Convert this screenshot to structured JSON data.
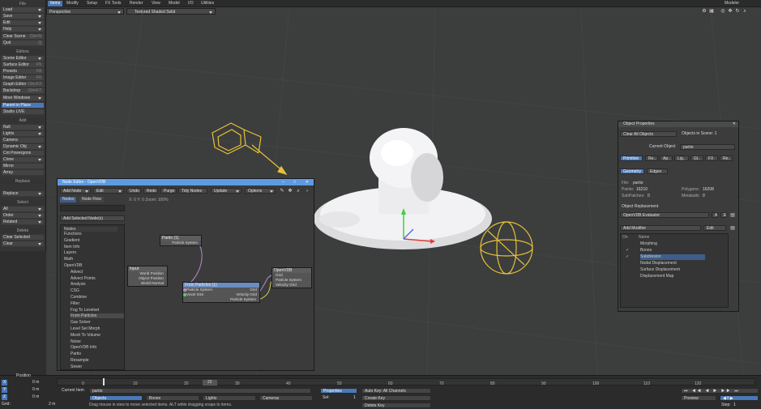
{
  "topbar": {
    "tabs": [
      "Items",
      "Modify",
      "Setup",
      "FX Tools",
      "Render",
      "View",
      "Model",
      "I/O",
      "Utilities"
    ],
    "active": "Items",
    "right_label": "Modeler"
  },
  "left": {
    "file": "File",
    "load": "Load",
    "save": "Save",
    "edit": "Edit",
    "help": "Help",
    "clear_scene": "Clear Scene",
    "clear_scene_key": "Ctrl+N",
    "quit": "Quit",
    "quit_key": "Q",
    "editors": "Editors",
    "scene_editor": "Scene Editor",
    "surface_editor": "Surface Editor",
    "surface_editor_key": "F5",
    "presets": "Presets",
    "presets_key": "F8",
    "image_editor": "Image Editor",
    "image_editor_key": "F6",
    "graph_editor": "Graph Editor",
    "graph_editor_key": "Ctrl+F2",
    "backdrop": "Backdrop",
    "backdrop_key": "Ctrl+F7",
    "more_windows": "More Windows",
    "parent_in_place": "Parent in Place",
    "studio_live": "Studio LIVE",
    "add": "Add",
    "null": "Null",
    "lights": "Lights",
    "camera": "Camera",
    "dynamic_obj": "Dynamic Obj",
    "cnt_powergons": "Cnt Powergons",
    "clone": "Clone",
    "mirror": "Mirror",
    "array": "Array",
    "replace_head": "Replace",
    "replace": "Replace",
    "select_head": "Select",
    "all": "All",
    "order": "Order",
    "related": "Related",
    "delete_head": "Delete",
    "clear_selected": "Clear Selected",
    "clear": "Clear"
  },
  "viewport": {
    "view": "Perspective",
    "shading": "Textured Shaded Solid"
  },
  "node_editor": {
    "title": "Node Editor - OpenVDB",
    "add_node": "Add Node",
    "edit": "Edit",
    "undo": "Undo",
    "redo": "Redo",
    "purge": "Purge",
    "tidy": "Tidy Nodes",
    "update": "Update",
    "options": "Options",
    "tab_nodes": "Nodes",
    "tab_flow": "Node Flow",
    "coords": "X: 0 Y: 0 Zoom: 100%",
    "add_selected": "Add Selected Node(s)",
    "nodes_label": "Nodes",
    "tree": [
      "Functions",
      "Gradient",
      "Item Info",
      "Layers",
      "Math",
      "OpenVDB",
      "Advect",
      "Advect Points",
      "Analysis",
      "CSG",
      "Combine",
      "Filter",
      "Fog To Levelset",
      "From Particles",
      "Gas Solver",
      "Level Set Morph",
      "Mesh To Volume",
      "Noise",
      "OpenVDB Info",
      "Partio",
      "Resample",
      "Sewer"
    ],
    "nodes": {
      "partio": {
        "title": "Partio (1)",
        "ports": [
          "Particle System"
        ]
      },
      "input": {
        "title": "Input",
        "ports": [
          "World Position",
          "Object Position",
          "World Normal"
        ]
      },
      "from_particles": {
        "title": "From Particles (1)",
        "ports": [
          "Particle System",
          "Grid",
          "Voxel Size",
          "Velocity Grid",
          "Particle System"
        ]
      },
      "openvdb": {
        "title": "OpenVDB",
        "ports": [
          "Grid",
          "Particle System",
          "Velocity Grid"
        ]
      }
    }
  },
  "properties": {
    "title": "Object Properties",
    "clear_all": "Clear All Objects",
    "objects_in_scene": "Objects in Scene: 1",
    "current_object_label": "Current Object",
    "current_object": "partio",
    "tabs": [
      "Primitive",
      "Re..",
      "Ap..",
      "Lig..",
      "Gl..",
      "FX",
      "Re.."
    ],
    "subtabs": [
      "Geometry",
      "Edges"
    ],
    "file_label": "File:",
    "file": "partio",
    "points_label": "Points:",
    "points": "16210",
    "polygons_label": "Polygons:",
    "polygons": "16208",
    "subpatches_label": "SubPatches:",
    "subpatches": "0",
    "metaballs_label": "Metaballs:",
    "metaballs": "0",
    "replacement_label": "Object Replacement",
    "replacement": "OpenVDB Evaluator",
    "add_modifier": "Add Modifier",
    "edit": "Edit",
    "col_on": "On",
    "col_name": "Name",
    "modifiers": [
      {
        "on": "",
        "name": "Morphing"
      },
      {
        "on": "✓",
        "name": "Bones"
      },
      {
        "on": "✓",
        "name": "Subdivision"
      },
      {
        "on": "",
        "name": "Nodal Displacement"
      },
      {
        "on": "",
        "name": "Surface Displacement"
      },
      {
        "on": "",
        "name": "Displacement Map"
      }
    ]
  },
  "timeline": {
    "position_label": "Position",
    "x": "X",
    "y": "Y",
    "z": "Z",
    "x_val": "0 m",
    "y_val": "0 m",
    "z_val": "0 m",
    "grid_label": "Grid:",
    "grid_val": "2 m",
    "ticks": [
      "0",
      "10",
      "20",
      "30",
      "40",
      "50",
      "60",
      "70",
      "80",
      "90",
      "100",
      "110",
      "120"
    ],
    "end": "120",
    "current_frame": "22",
    "current_item_label": "Current Item",
    "current_item": "partio",
    "objects": "Objects",
    "bones": "Bones",
    "lights": "Lights",
    "cameras": "Cameras",
    "properties": "Properties",
    "sel_label": "Sel:",
    "sel_val": "1",
    "autokey": "Auto Key: All Channels",
    "create_key": "Create Key",
    "delete_key": "Delete Key",
    "preview": "Preview",
    "step_label": "Step:",
    "step_val": "1",
    "status": "Drag mouse in view to move selected items. ALT while dragging snaps to items."
  }
}
